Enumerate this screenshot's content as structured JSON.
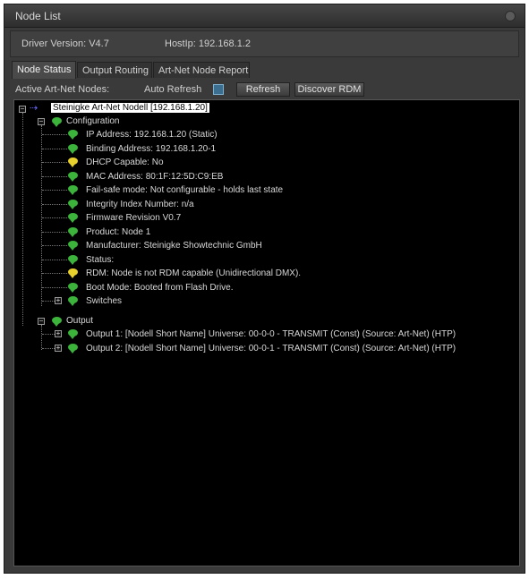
{
  "window": {
    "title": "Node List"
  },
  "info": {
    "driver_version": "Driver Version: V4.7",
    "host_ip": "HostIp: 192.168.1.2"
  },
  "tabs": [
    {
      "label": "Node Status",
      "active": true
    },
    {
      "label": "Output Routing",
      "active": false
    },
    {
      "label": "Art-Net Node Report",
      "active": false
    }
  ],
  "toolbar": {
    "active_label": "Active Art-Net Nodes:",
    "auto_refresh_label": "Auto Refresh",
    "refresh_button": "Refresh",
    "discover_button": "Discover RDM"
  },
  "tree": {
    "root": "Steinigke Art-Net Nodell [192.168.1.20]",
    "configuration": {
      "label": "Configuration",
      "items": [
        {
          "text": "IP Address: 192.168.1.20 (Static)",
          "icon": "green"
        },
        {
          "text": "Binding Address: 192.168.1.20-1",
          "icon": "green"
        },
        {
          "text": "DHCP Capable: No",
          "icon": "yellow"
        },
        {
          "text": "MAC Address: 80:1F:12:5D:C9:EB",
          "icon": "green"
        },
        {
          "text": "Fail-safe mode: Not configurable - holds last state",
          "icon": "green"
        },
        {
          "text": "Integrity Index Number: n/a",
          "icon": "green"
        },
        {
          "text": "Firmware Revision V0.7",
          "icon": "green"
        },
        {
          "text": "Product: Node 1",
          "icon": "green"
        },
        {
          "text": "Manufacturer: Steinigke Showtechnic GmbH",
          "icon": "green"
        },
        {
          "text": "Status:",
          "icon": "green"
        },
        {
          "text": "RDM: Node is not RDM capable (Unidirectional DMX).",
          "icon": "yellow"
        },
        {
          "text": "Boot Mode: Booted from Flash Drive.",
          "icon": "green"
        },
        {
          "text": "Switches",
          "icon": "green"
        }
      ]
    },
    "output": {
      "label": "Output",
      "items": [
        {
          "text": "Output 1: [Nodell Short Name] Universe: 00-0-0  - TRANSMIT   (Const) (Source: Art-Net) (HTP)",
          "icon": "green"
        },
        {
          "text": "Output 2: [Nodell Short Name] Universe: 00-0-1  - TRANSMIT   (Const) (Source: Art-Net) (HTP)",
          "icon": "green"
        }
      ]
    }
  }
}
